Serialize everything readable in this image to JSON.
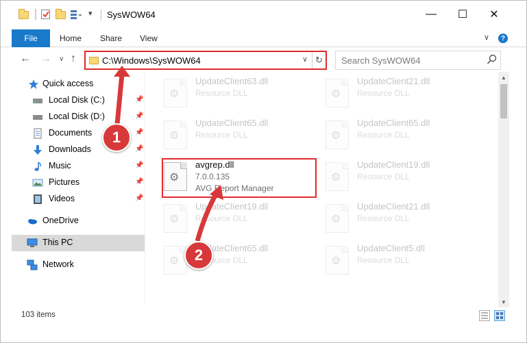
{
  "window": {
    "title": "SysWOW64",
    "minimize_glyph": "—",
    "maximize_glyph": "☐",
    "close_glyph": "✕"
  },
  "ribbon": {
    "tabs": [
      "File",
      "Home",
      "Share",
      "View"
    ],
    "help_glyph": "?",
    "collapse_glyph": "∨"
  },
  "nav": {
    "back_glyph": "←",
    "forward_glyph": "→",
    "recent_glyph": "∨",
    "up_glyph": "↑",
    "address": "C:\\Windows\\SysWOW64",
    "address_dropdown_glyph": "∨",
    "refresh_glyph": "↻",
    "search_placeholder": "Search SysWOW64"
  },
  "sidebar": {
    "items": [
      {
        "label": "Quick access",
        "icon": "star-icon"
      },
      {
        "label": "Local Disk (C:)",
        "icon": "drive-icon",
        "pinned": true
      },
      {
        "label": "Local Disk (D:)",
        "icon": "drive-icon",
        "pinned": true
      },
      {
        "label": "Documents",
        "icon": "documents-icon",
        "pinned": true
      },
      {
        "label": "Downloads",
        "icon": "downloads-icon",
        "pinned": true
      },
      {
        "label": "Music",
        "icon": "music-icon",
        "pinned": true
      },
      {
        "label": "Pictures",
        "icon": "pictures-icon",
        "pinned": true
      },
      {
        "label": "Videos",
        "icon": "videos-icon",
        "pinned": true
      },
      {
        "label": "OneDrive",
        "icon": "onedrive-icon"
      },
      {
        "label": "This PC",
        "icon": "pc-icon",
        "selected": true
      },
      {
        "label": "Network",
        "icon": "network-icon"
      }
    ],
    "pin_glyph": "📌"
  },
  "files": [
    {
      "name": "UpdateClient63.dll",
      "line2": "Resource DLL",
      "line3": "",
      "faded": true
    },
    {
      "name": "UpdateClient21.dll",
      "line2": "Resource DLL",
      "line3": "",
      "faded": true
    },
    {
      "name": "UpdateClient65.dll",
      "line2": "Resource DLL",
      "line3": "",
      "faded": true
    },
    {
      "name": "UpdateClient65.dll",
      "line2": "Resource DLL",
      "line3": "",
      "faded": true
    },
    {
      "name": "avgrep.dll",
      "line2": "7.0.0.135",
      "line3": "AVG Report Manager",
      "faded": false
    },
    {
      "name": "UpdateClient19.dll",
      "line2": "Resource DLL",
      "line3": "",
      "faded": true
    },
    {
      "name": "UpdateClient19.dll",
      "line2": "Resource DLL",
      "line3": "",
      "faded": true
    },
    {
      "name": "UpdateClient21.dll",
      "line2": "Resource DLL",
      "line3": "",
      "faded": true
    },
    {
      "name": "UpdateClient65.dll",
      "line2": "Resource DLL",
      "line3": "",
      "faded": true
    },
    {
      "name": "UpdateClient5.dll",
      "line2": "Resource DLL",
      "line3": "",
      "faded": true
    }
  ],
  "status": {
    "item_count": "103 items"
  },
  "annotations": {
    "step1": "1",
    "step2": "2",
    "color": "#d7393a"
  },
  "colors": {
    "accent": "#1979ca",
    "highlight": "#e02a2a",
    "folder": "#f8d775"
  }
}
